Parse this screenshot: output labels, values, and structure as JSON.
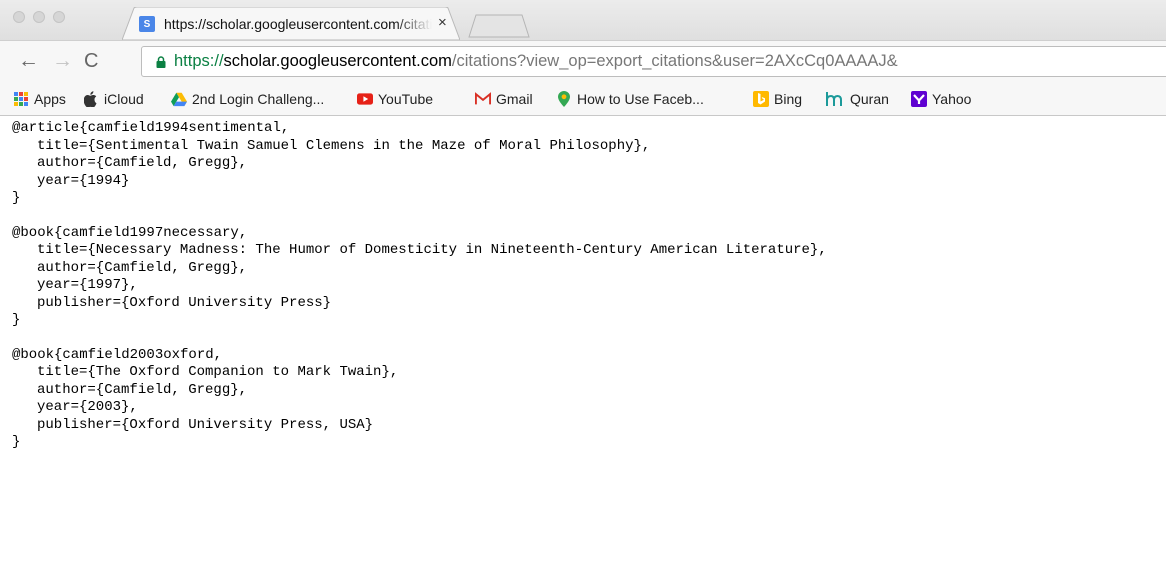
{
  "tab": {
    "title": "https://scholar.googleusercontent.com/citations?view_op=export_citations",
    "close": "×",
    "favicon": "S"
  },
  "toolbar": {
    "back_icon": "←",
    "forward_icon": "→",
    "reload_icon": "C",
    "url_scheme": "https://",
    "url_host": "scholar.googleusercontent.com",
    "url_path": "/citations?view_op=export_citations&user=2AXcCq0AAAAJ&"
  },
  "bookmarks": [
    {
      "label": "Apps",
      "icon": "apps-icon"
    },
    {
      "label": "iCloud",
      "icon": "apple-icon"
    },
    {
      "label": "2nd Login Challeng...",
      "icon": "google-drive-icon"
    },
    {
      "label": "YouTube",
      "icon": "youtube-icon"
    },
    {
      "label": "Gmail",
      "icon": "gmail-icon"
    },
    {
      "label": "How to Use Faceb...",
      "icon": "location-pin-icon"
    },
    {
      "label": "Bing",
      "icon": "bing-icon"
    },
    {
      "label": "Quran",
      "icon": "quran-icon"
    },
    {
      "label": "Yahoo",
      "icon": "yahoo-icon"
    }
  ],
  "colors": {
    "url_scheme": "#0b8043",
    "youtube": "#e62117",
    "gmail": "#d93025",
    "bing": "#ffb900",
    "yahoo": "#5f01d1"
  },
  "entries": [
    {
      "head": "@article{camfield1994sentimental,",
      "fields": [
        "title={Sentimental Twain Samuel Clemens in the Maze of Moral Philosophy},",
        "author={Camfield, Gregg},",
        "year={1994}"
      ],
      "close": "}"
    },
    {
      "head": "@book{camfield1997necessary,",
      "fields": [
        "title={Necessary Madness: The Humor of Domesticity in Nineteenth-Century American Literature},",
        "author={Camfield, Gregg},",
        "year={1997},",
        "publisher={Oxford University Press}"
      ],
      "close": "}"
    },
    {
      "head": "@book{camfield2003oxford,",
      "fields": [
        "title={The Oxford Companion to Mark Twain},",
        "author={Camfield, Gregg},",
        "year={2003},",
        "publisher={Oxford University Press, USA}"
      ],
      "close": "}"
    }
  ]
}
